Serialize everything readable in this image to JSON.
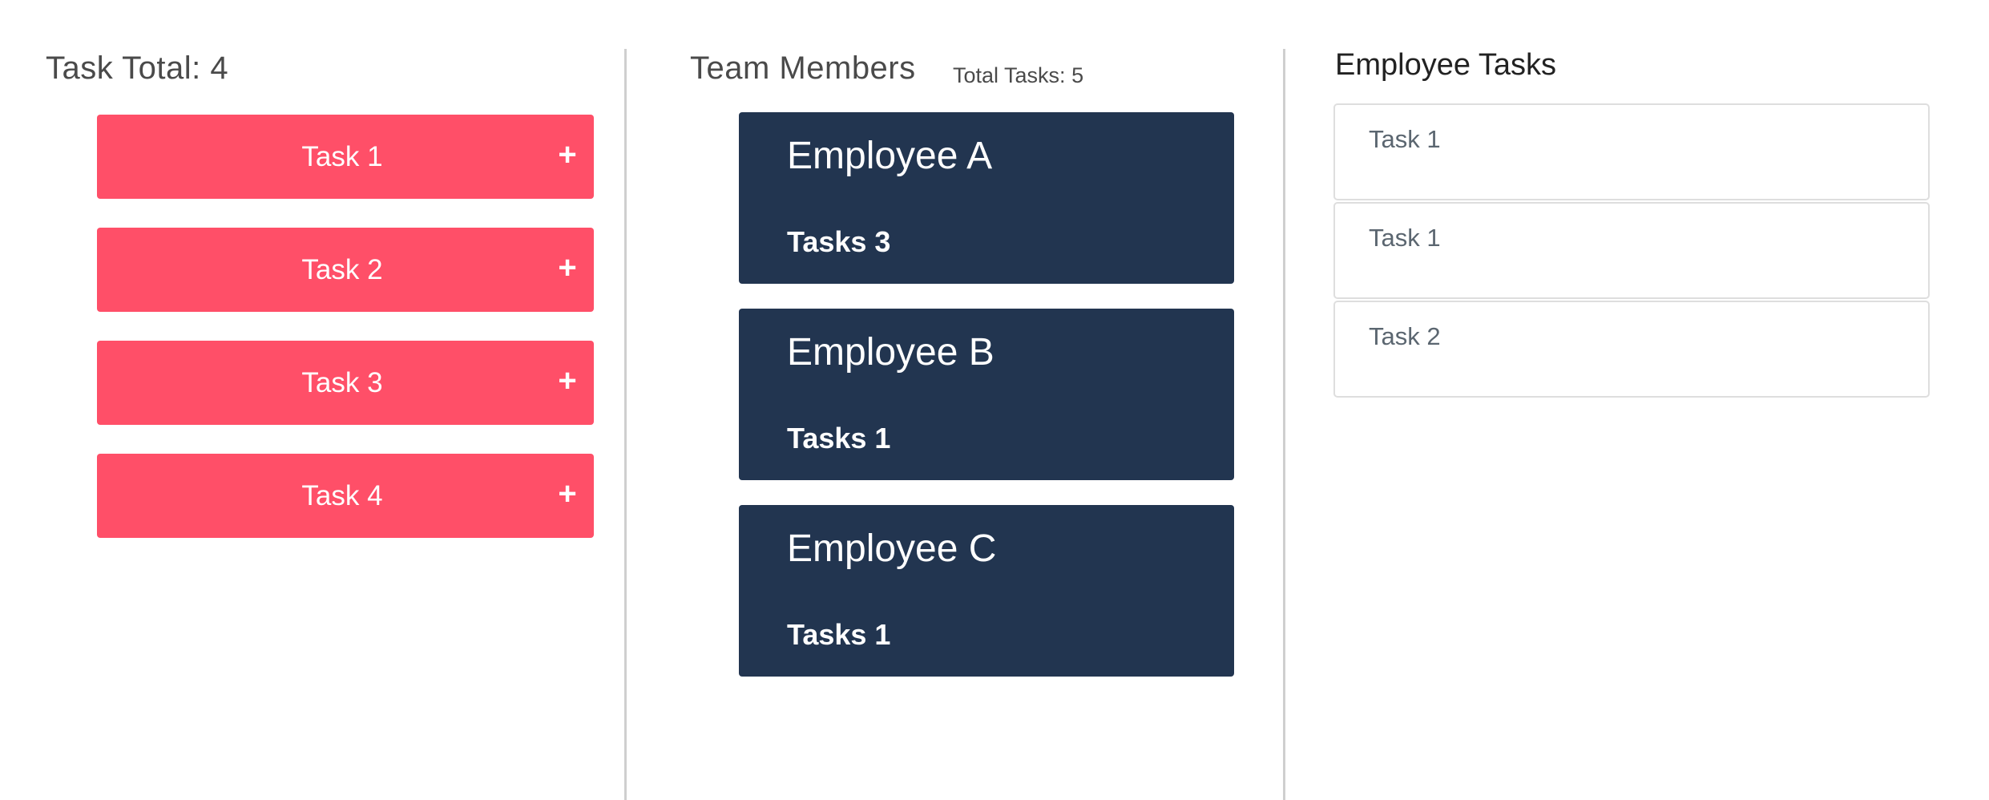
{
  "tasks_panel": {
    "title": "Task Total: 4",
    "items": [
      {
        "label": "Task 1",
        "action": "+"
      },
      {
        "label": "Task 2",
        "action": "+"
      },
      {
        "label": "Task 3",
        "action": "+"
      },
      {
        "label": "Task 4",
        "action": "+"
      }
    ]
  },
  "team_panel": {
    "title": "Team Members",
    "total_tasks": "Total Tasks: 5",
    "members": [
      {
        "name": "Employee A",
        "tasks": "Tasks 3"
      },
      {
        "name": "Employee B",
        "tasks": "Tasks 1"
      },
      {
        "name": "Employee C",
        "tasks": "Tasks 1"
      }
    ]
  },
  "employee_tasks_panel": {
    "title": "Employee Tasks",
    "items": [
      {
        "label": "Task 1"
      },
      {
        "label": "Task 1"
      },
      {
        "label": "Task 2"
      }
    ]
  },
  "colors": {
    "task_button": "#ff4f68",
    "employee_card": "#223550",
    "divider": "#cfcfcf"
  }
}
